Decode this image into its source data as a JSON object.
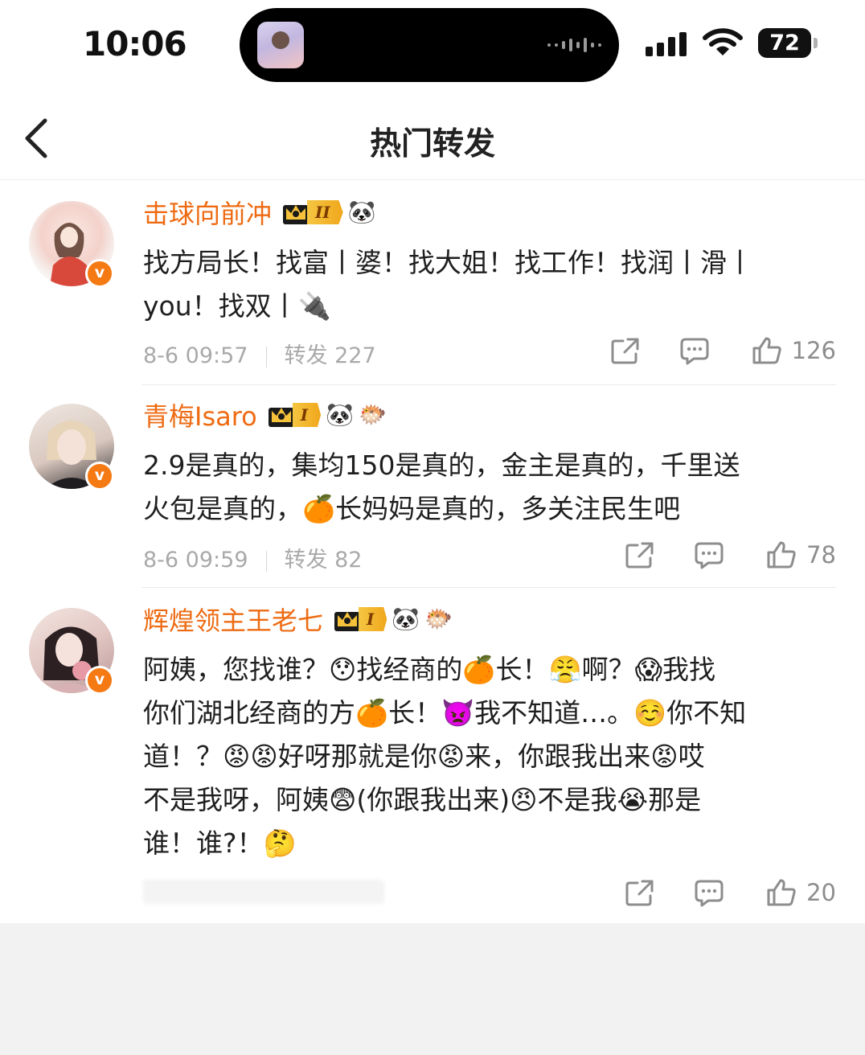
{
  "status_bar": {
    "time": "10:06",
    "battery": "72"
  },
  "nav": {
    "title": "热门转发"
  },
  "comments": [
    {
      "username": "击球向前冲",
      "rank": "II",
      "badges": [
        "🐼"
      ],
      "content_lines": [
        "找方局长！找富丨婆！找大姐！找工作！找润丨滑丨",
        "you！找双丨🔌"
      ],
      "date": "8-6 09:57",
      "repost": "转发 227",
      "likes": "126"
    },
    {
      "username": "青梅Isaro",
      "rank": "I",
      "badges": [
        "🐼",
        "🐡"
      ],
      "content_lines": [
        "2.9是真的，集均150是真的，金主是真的，千里送",
        "火包是真的，🍊长妈妈是真的，多关注民生吧"
      ],
      "date": "8-6 09:59",
      "repost": "转发 82",
      "likes": "78"
    },
    {
      "username": "辉煌领主王老七",
      "rank": "I",
      "badges": [
        "🐼",
        "🐡"
      ],
      "content_lines": [
        "阿姨，您找谁？😯找经商的🍊长！😤啊？😱我找",
        "你们湖北经商的方🍊长！👿我不知道…。☺️你不知",
        "道！？😡😡好呀那就是你😡来，你跟我出来😡哎",
        "不是我呀，阿姨😨(你跟我出来)😠不是我😭那是",
        "谁！谁?！🤔"
      ],
      "likes": "20"
    }
  ],
  "colors": {
    "username": "#ee6b13",
    "vip_badge": "#f57a14",
    "meta": "#a9a9a9"
  }
}
